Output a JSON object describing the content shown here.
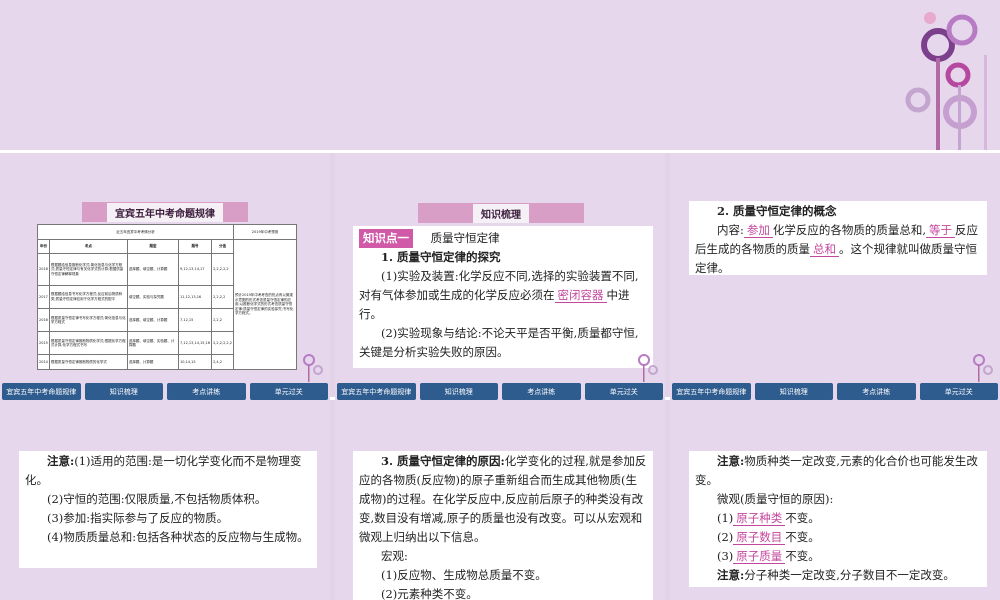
{
  "nav": [
    "宜宾五年中考命题规律",
    "知识梳理",
    "考点讲练",
    "单元过关"
  ],
  "slide1": {
    "banner": "宜宾五年中考命题规律",
    "table_caption": "近五年宜宾中考考情分析",
    "table_caption2": "2019年中考预测",
    "headers": [
      "年份",
      "考点",
      "题型",
      "题号",
      "分值"
    ],
    "rows": [
      [
        "2018",
        "根据题给信息推断化学式;简化信息与化学方程式;质量守恒定律与有关化学式的计算;根据质量守恒定律解释现象",
        "选择题、填空题、计算题",
        "9,12,13,14,17",
        "2,2,2,2,2"
      ],
      [
        "2017",
        "根据题给信息书写化学方程式;反应前后物质种类;质量守恒定律应用于化学方程式的配平",
        "填空题、实验与探究题",
        "11,12,13,16",
        "2,2,2,2"
      ],
      [
        "2016",
        "根据质量守恒定律书写化学方程式;简化信息与化学方程式",
        "选择题、填空题、计算题",
        "7,12,15",
        "2,2,2"
      ],
      [
        "2015",
        "根据质量守恒定律推断物质化学式;根据化学方程式计算;化学方程式书写",
        "选择题、填空题、实验题、计算题",
        "7,12,13,14,15,16",
        "2,2,2,2,2,2"
      ],
      [
        "2014",
        "根据质量守恒定律推断物质的化学式",
        "选择题、计算题",
        "10,14,15",
        "2,4,2"
      ]
    ],
    "prediction": "预计2019年中考考查的热点有以微观示意图的形式考查质量守恒定律的应用;以推断化学式的形式考查质量守恒定律;质量守恒定律的实验探究;书写化学方程式。"
  },
  "slide2": {
    "banner": "知识梳理",
    "kp_label": "知识点一",
    "kp_title": "质量守恒定律",
    "h1": "1. 质量守恒定律的探究",
    "p1a": "(1)实验及装置:化学反应不同,选择的实验装置不同,对有气体参加或生成的化学反应必须在",
    "p1_fill": "密闭容器",
    "p1b": "中进行。",
    "p2": "(2)实验现象与结论:不论天平是否平衡,质量都守恒,关键是分析实验失败的原因。"
  },
  "slide3": {
    "h": "2. 质量守恒定律的概念",
    "a": "内容:",
    "fill1": "参加",
    "b": "化学反应的各物质的质量总和,",
    "fill2": "等于",
    "c": "反应后生成的各物质的质量",
    "fill3": "总和",
    "d": "。这个规律就叫做质量守恒定律。"
  },
  "slide4": {
    "note_label": "注意:",
    "l1": "(1)适用的范围:是一切化学变化而不是物理变化。",
    "l2": "(2)守恒的范围:仅限质量,不包括物质体积。",
    "l3": "(3)参加:指实际参与了反应的物质。",
    "l4": "(4)物质质量总和:包括各种状态的反应物与生成物。"
  },
  "slide5": {
    "h": "3. 质量守恒定律的原因:",
    "p": "化学变化的过程,就是参加反应的各物质(反应物)的原子重新组合而生成其他物质(生成物)的过程。在化学反应中,反应前后原子的种类没有改变,数目没有增减,原子的质量也没有改变。可以从宏观和微观上归纳出以下信息。",
    "macro": "宏观:",
    "m1": "(1)反应物、生成物总质量不变。",
    "m2": "(2)元素种类不变。"
  },
  "slide6": {
    "note_label": "注意:",
    "l1": "物质种类一定改变,元素的化合价也可能发生改变。",
    "micro": "微观(质量守恒的原因):",
    "i1": "(1)",
    "f1": "原子种类",
    "i2": "(2)",
    "f2": "原子数目",
    "i3": "(3)",
    "f3": "原子质量",
    "suffix": "不变。",
    "note2": "分子种类一定改变,分子数目不一定改变。"
  },
  "colors": {
    "nav": "#2f5c8f",
    "accent": "#c5469d",
    "banner": "#d99ec5",
    "bg": "#e2d3e8"
  }
}
